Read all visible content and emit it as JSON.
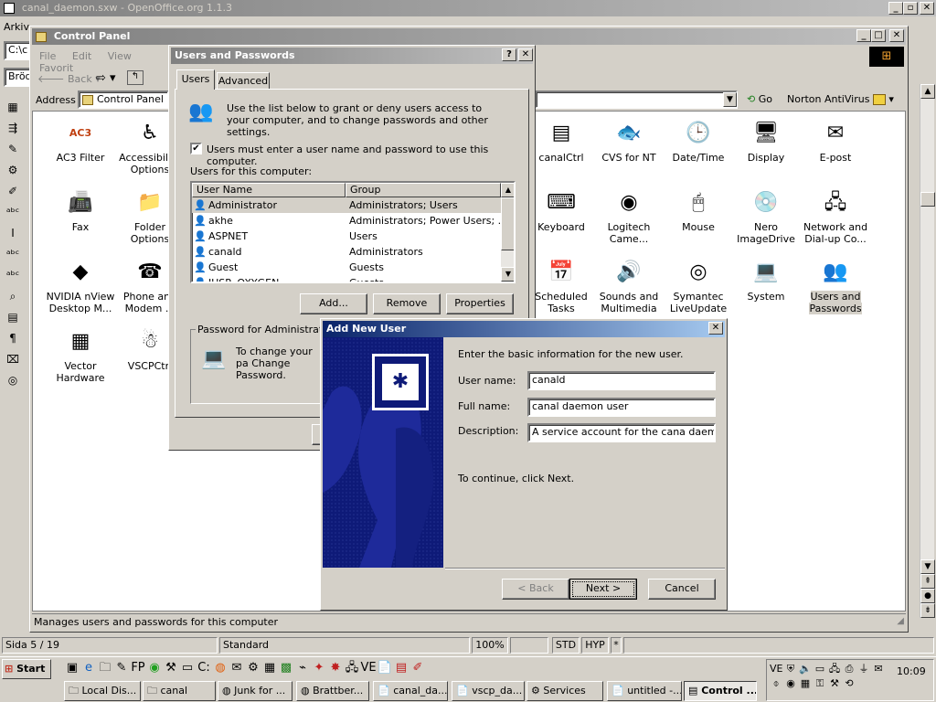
{
  "ooo": {
    "title": "canal_daemon.sxw - OpenOffice.org 1.1.3",
    "menu_first": "Arkiv",
    "combo1": "C:\\c",
    "combo2": "Bröd",
    "status": {
      "page": "Sida  5 / 19",
      "style": "Standard",
      "zoom": "100%",
      "std": "STD",
      "hyp": "HYP",
      "star": "*"
    }
  },
  "cp": {
    "title": "Control Panel",
    "menu": [
      "File",
      "Edit",
      "View",
      "Favorit"
    ],
    "back": "Back",
    "address_label": "Address",
    "address": "Control Panel",
    "go": "Go",
    "norton": "Norton AntiVirus",
    "status": "Manages users and passwords for this computer",
    "icons": [
      {
        "label": "AC3 Filter",
        "icon": "ac3-filter-icon",
        "glyph": "AC3"
      },
      {
        "label": "Accessibility Options",
        "icon": "accessibility-icon",
        "glyph": "♿"
      },
      {
        "label": "Fax",
        "icon": "fax-icon",
        "glyph": "📠"
      },
      {
        "label": "Folder Options",
        "icon": "folder-options-icon",
        "glyph": "📁"
      },
      {
        "label": "NVIDIA nView Desktop M...",
        "icon": "nvidia-icon",
        "glyph": "◆"
      },
      {
        "label": "Phone and Modem ...",
        "icon": "phone-modem-icon",
        "glyph": "☎"
      },
      {
        "label": "Vector Hardware",
        "icon": "vector-hardware-icon",
        "glyph": "▦"
      },
      {
        "label": "VSCPCtrl",
        "icon": "vscpctrl-icon",
        "glyph": "☃"
      },
      {
        "label": "canalCtrl",
        "icon": "canalctrl-icon",
        "glyph": "▤"
      },
      {
        "label": "CVS for NT",
        "icon": "cvs-icon",
        "glyph": "🐟"
      },
      {
        "label": "Date/Time",
        "icon": "datetime-icon",
        "glyph": "🕒"
      },
      {
        "label": "Display",
        "icon": "display-icon",
        "glyph": "🖥"
      },
      {
        "label": "E-post",
        "icon": "epost-icon",
        "glyph": "✉"
      },
      {
        "label": "Keyboard",
        "icon": "keyboard-icon",
        "glyph": "⌨"
      },
      {
        "label": "Logitech Came...",
        "icon": "logitech-icon",
        "glyph": "◉"
      },
      {
        "label": "Mouse",
        "icon": "mouse-icon",
        "glyph": "🖱"
      },
      {
        "label": "Nero ImageDrive",
        "icon": "nero-icon",
        "glyph": "💿"
      },
      {
        "label": "Network and Dial-up Co...",
        "icon": "network-icon",
        "glyph": "🖧"
      },
      {
        "label": "Scheduled Tasks",
        "icon": "scheduled-tasks-icon",
        "glyph": "📅"
      },
      {
        "label": "Sounds and Multimedia",
        "icon": "sounds-icon",
        "glyph": "🔊"
      },
      {
        "label": "Symantec LiveUpdate",
        "icon": "liveupdate-icon",
        "glyph": "◎"
      },
      {
        "label": "System",
        "icon": "system-icon",
        "glyph": "💻"
      },
      {
        "label": "Users and Passwords",
        "icon": "users-passwords-icon",
        "glyph": "👥"
      }
    ]
  },
  "up": {
    "title": "Users and Passwords",
    "help": "?",
    "tabs": [
      "Users",
      "Advanced"
    ],
    "intro": "Use the list below to grant or deny users access to your computer, and to change passwords and other settings.",
    "checkbox": "Users must enter a user name and password to use this computer.",
    "check_mark": "✔",
    "list_label": "Users for this computer:",
    "col_user": "User Name",
    "col_group": "Group",
    "rows": [
      {
        "user": "Administrator",
        "group": "Administrators; Users"
      },
      {
        "user": "akhe",
        "group": "Administrators; Power Users; ..."
      },
      {
        "user": "ASPNET",
        "group": "Users"
      },
      {
        "user": "canald",
        "group": "Administrators"
      },
      {
        "user": "Guest",
        "group": "Guests"
      },
      {
        "user": "IUSR_OXYGEN",
        "group": "Guests"
      }
    ],
    "add": "Add...",
    "remove": "Remove",
    "properties": "Properties",
    "pw_group": "Password for Administrator",
    "pw_text": "To change your pa Change Password."
  },
  "anu": {
    "title": "Add New User",
    "intro": "Enter the basic information for the new user.",
    "user_label": "User name:",
    "user_value": "canald",
    "full_label": "Full name:",
    "full_value": "canal daemon user",
    "desc_label": "Description:",
    "desc_value": "A service account for the cana daemon",
    "continue": "To continue, click Next.",
    "back": "< Back",
    "next": "Next >",
    "cancel": "Cancel"
  },
  "taskbar": {
    "start": "Start",
    "clock": "10:09",
    "tasks": [
      "Local Dis...",
      "canal",
      "Junk for ...",
      "Brattber...",
      "canal_da...",
      "vscp_da...",
      "Services",
      "untitled -...",
      "Control ..."
    ]
  }
}
